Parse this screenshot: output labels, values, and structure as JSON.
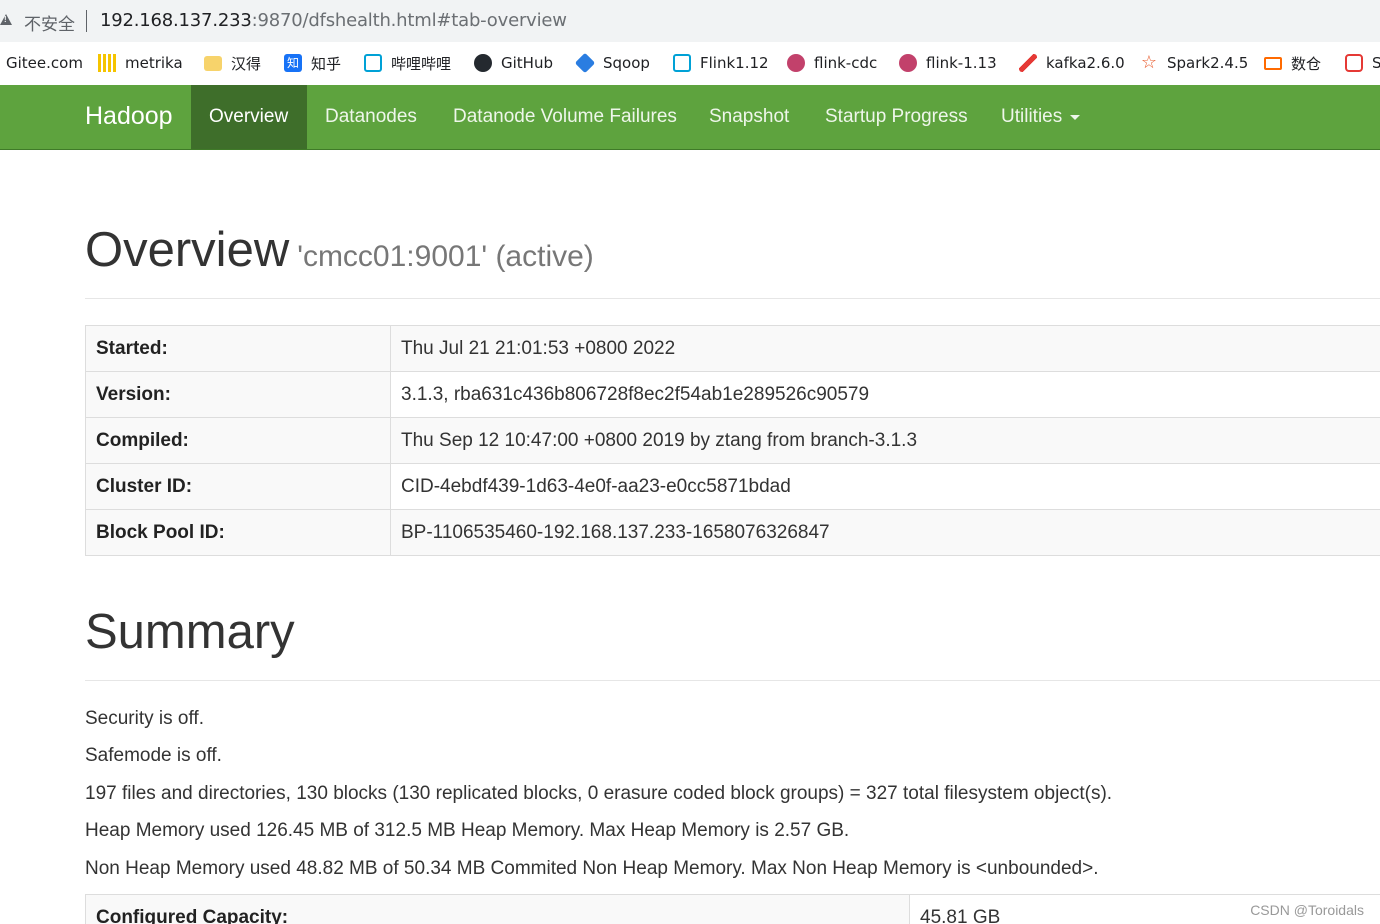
{
  "browser": {
    "security_label": "不安全",
    "url_host": "192.168.137.233",
    "url_rest": ":9870/dfshealth.html#tab-overview"
  },
  "bookmarks": [
    {
      "label": "Gitee.com",
      "icon": "gitee-icon"
    },
    {
      "label": "metrika",
      "icon": "metrika-icon"
    },
    {
      "label": "汉得",
      "icon": "folder-icon"
    },
    {
      "label": "知乎",
      "icon": "zhihu-icon"
    },
    {
      "label": "哔哩哔哩",
      "icon": "bilibili-icon"
    },
    {
      "label": "GitHub",
      "icon": "github-icon"
    },
    {
      "label": "Sqoop",
      "icon": "sqoop-icon"
    },
    {
      "label": "Flink1.12",
      "icon": "bilibili-icon"
    },
    {
      "label": "flink-cdc",
      "icon": "flink-icon"
    },
    {
      "label": "flink-1.13",
      "icon": "flink-icon"
    },
    {
      "label": "kafka2.6.0",
      "icon": "feather-icon"
    },
    {
      "label": "Spark2.4.5",
      "icon": "star-icon"
    },
    {
      "label": "数仓",
      "icon": "bracket-icon"
    },
    {
      "label": "S",
      "icon": "shield-icon"
    }
  ],
  "navbar": {
    "brand": "Hadoop",
    "items": [
      "Overview",
      "Datanodes",
      "Datanode Volume Failures",
      "Snapshot",
      "Startup Progress",
      "Utilities"
    ],
    "active": "Overview"
  },
  "overview": {
    "title": "Overview",
    "subtitle": "'cmcc01:9001' (active)",
    "rows": [
      {
        "label": "Started:",
        "value": "Thu Jul 21 21:01:53 +0800 2022"
      },
      {
        "label": "Version:",
        "value": "3.1.3, rba631c436b806728f8ec2f54ab1e289526c90579"
      },
      {
        "label": "Compiled:",
        "value": "Thu Sep 12 10:47:00 +0800 2019 by ztang from branch-3.1.3"
      },
      {
        "label": "Cluster ID:",
        "value": "CID-4ebdf439-1d63-4e0f-aa23-e0cc5871bdad"
      },
      {
        "label": "Block Pool ID:",
        "value": "BP-1106535460-192.168.137.233-1658076326847"
      }
    ]
  },
  "summary": {
    "title": "Summary",
    "lines": [
      "Security is off.",
      "Safemode is off.",
      "197 files and directories, 130 blocks (130 replicated blocks, 0 erasure coded block groups) = 327 total filesystem object(s).",
      "Heap Memory used 126.45 MB of 312.5 MB Heap Memory. Max Heap Memory is 2.57 GB.",
      "Non Heap Memory used 48.82 MB of 50.34 MB Commited Non Heap Memory. Max Non Heap Memory is <unbounded>."
    ],
    "rows": [
      {
        "label": "Configured Capacity:",
        "value": "45.81 GB"
      }
    ]
  },
  "watermark": "CSDN @Toroidals"
}
